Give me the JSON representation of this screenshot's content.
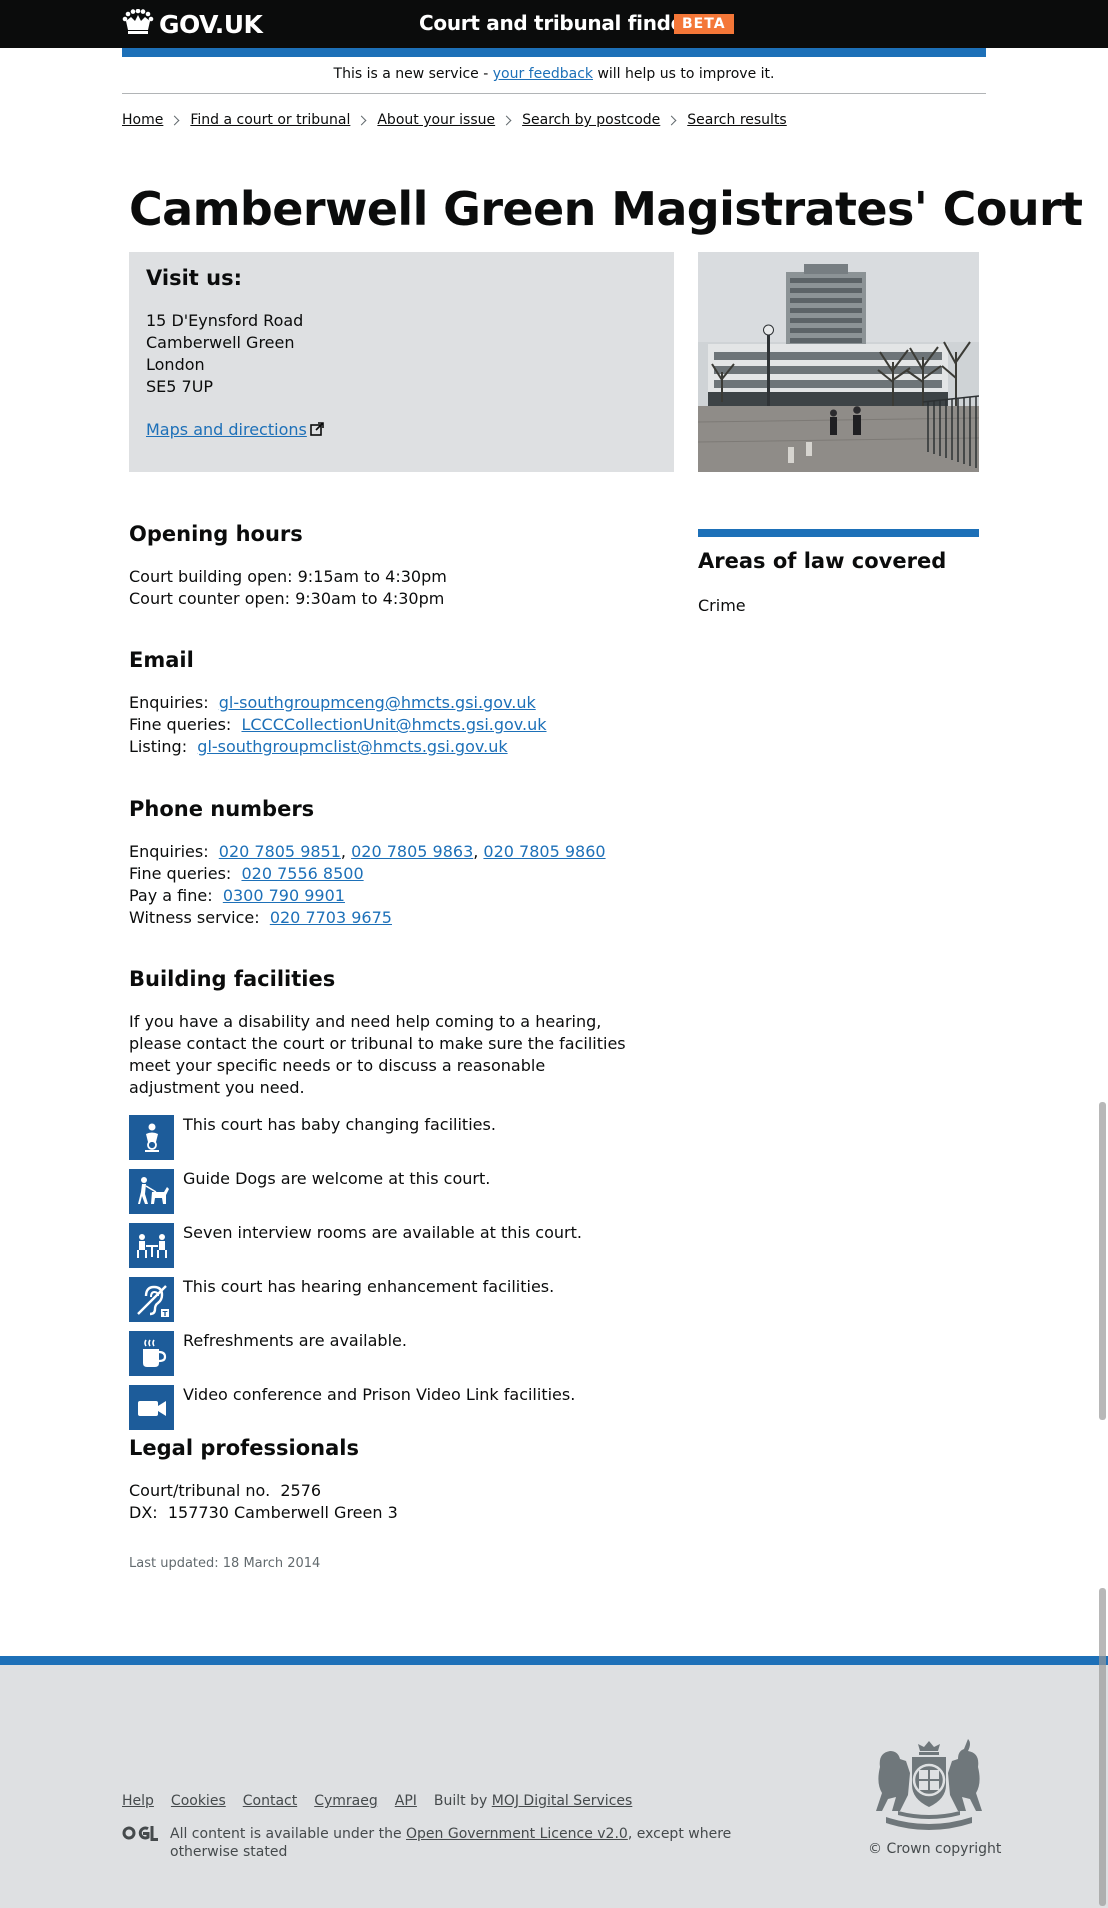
{
  "header": {
    "logo_text": "GOV.UK",
    "service_name": "Court and tribunal finder",
    "phase_tag": "BETA"
  },
  "phase_banner": {
    "before": "This is a new service - ",
    "link": "your feedback",
    "after": " will help us to improve it."
  },
  "breadcrumbs": [
    "Home",
    "Find a court or tribunal",
    "About your issue",
    "Search by postcode",
    "Search results"
  ],
  "page_title": "Camberwell Green Magistrates' Court",
  "visit": {
    "heading": "Visit us:",
    "address": [
      "15 D'Eynsford Road",
      "Camberwell Green",
      "London",
      "SE5 7UP"
    ],
    "maps_link": "Maps and directions"
  },
  "opening_hours": {
    "heading": "Opening hours",
    "lines": [
      "Court building open: 9:15am to 4:30pm",
      "Court counter open: 9:30am to 4:30pm"
    ]
  },
  "email": {
    "heading": "Email",
    "rows": [
      {
        "label": "Enquiries:",
        "value": "gl-southgroupmceng@hmcts.gsi.gov.uk"
      },
      {
        "label": "Fine queries:",
        "value": "LCCCCollectionUnit@hmcts.gsi.gov.uk"
      },
      {
        "label": "Listing:",
        "value": "gl-southgroupmclist@hmcts.gsi.gov.uk"
      }
    ]
  },
  "phones": {
    "heading": "Phone numbers",
    "enquiries_label": "Enquiries:",
    "enquiries": [
      "020 7805 9851",
      "020 7805 9863",
      "020 7805 9860"
    ],
    "fine_label": "Fine queries:",
    "fine": "020 7556 8500",
    "pay_label": "Pay a fine:",
    "pay": "0300 790 9901",
    "witness_label": "Witness service:",
    "witness": "020 7703 9675"
  },
  "facilities": {
    "heading": "Building facilities",
    "intro": "If you have a disability and need help coming to a hearing, please contact the court or tribunal to make sure the facilities meet your specific needs or to discuss a reasonable adjustment you need.",
    "items": [
      {
        "icon": "baby-changing-icon",
        "text": "This court has baby changing facilities."
      },
      {
        "icon": "guide-dog-icon",
        "text": "Guide Dogs are welcome at this court."
      },
      {
        "icon": "interview-room-icon",
        "text": "Seven interview rooms are available at this court."
      },
      {
        "icon": "hearing-loop-icon",
        "text": "This court has hearing enhancement facilities."
      },
      {
        "icon": "refreshments-icon",
        "text": "Refreshments are available."
      },
      {
        "icon": "video-camera-icon",
        "text": "Video conference and Prison Video Link facilities."
      }
    ]
  },
  "legal": {
    "heading": "Legal professionals",
    "court_no_label": "Court/tribunal no.",
    "court_no": "2576",
    "dx_label": "DX:",
    "dx": "157730 Camberwell Green 3"
  },
  "last_updated": "Last updated: 18 March 2014",
  "aside": {
    "heading": "Areas of law covered",
    "items": [
      "Crime"
    ]
  },
  "footer": {
    "links": [
      "Help",
      "Cookies",
      "Contact",
      "Cymraeg",
      "API"
    ],
    "built_by_prefix": "Built by ",
    "built_by_link": "MOJ Digital Services",
    "ogl_before": "All content is available under the ",
    "ogl_link": "Open Government Licence v2.0",
    "ogl_after": ", except where otherwise stated",
    "copyright": "© Crown copyright"
  },
  "colors": {
    "header_bg": "#0b0c0c",
    "brand_blue": "#1d70b8",
    "beta_tag": "#f47738",
    "link": "#1d70b8",
    "panel_grey": "#dee0e2",
    "icon_bg": "#1d5c9a"
  }
}
